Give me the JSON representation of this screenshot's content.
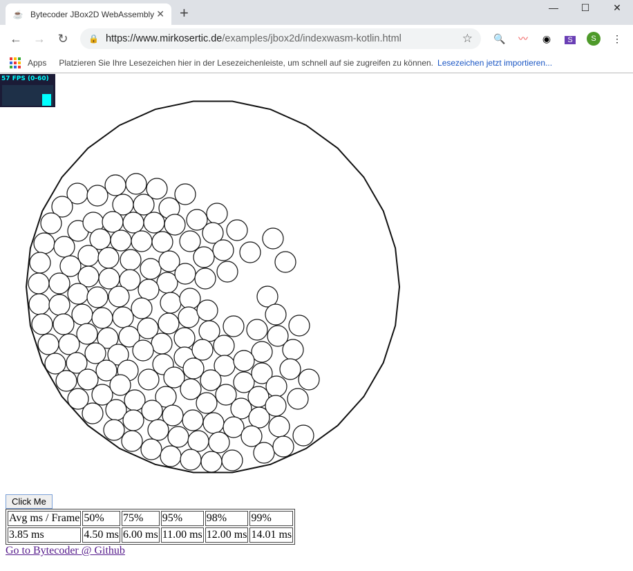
{
  "browser": {
    "tab_title": "Bytecoder JBox2D WebAssembly",
    "url_host": "https://www.mirkosertic.de",
    "url_path": "/examples/jbox2d/indexwasm-kotlin.html",
    "profile_initial": "S",
    "ext_initial": "S"
  },
  "bookmarks": {
    "apps_label": "Apps",
    "hint": "Platzieren Sie Ihre Lesezeichen hier in der Lesezeichenleiste, um schnell auf sie zugreifen zu können.",
    "import_link": "Lesezeichen jetzt importieren..."
  },
  "fps": {
    "label": "57 FPS (0-60)",
    "value": 57,
    "max": 60,
    "color": "#00ffff"
  },
  "page": {
    "button_label": "Click Me",
    "link_text": "Go to Bytecoder @ Github",
    "table": {
      "headers": [
        "Avg ms / Frame",
        "50%",
        "75%",
        "95%",
        "98%",
        "99%"
      ],
      "values": [
        "3.85 ms",
        "4.50 ms",
        "6.00 ms",
        "11.00 ms",
        "12.00 ms",
        "14.01 ms"
      ]
    }
  }
}
